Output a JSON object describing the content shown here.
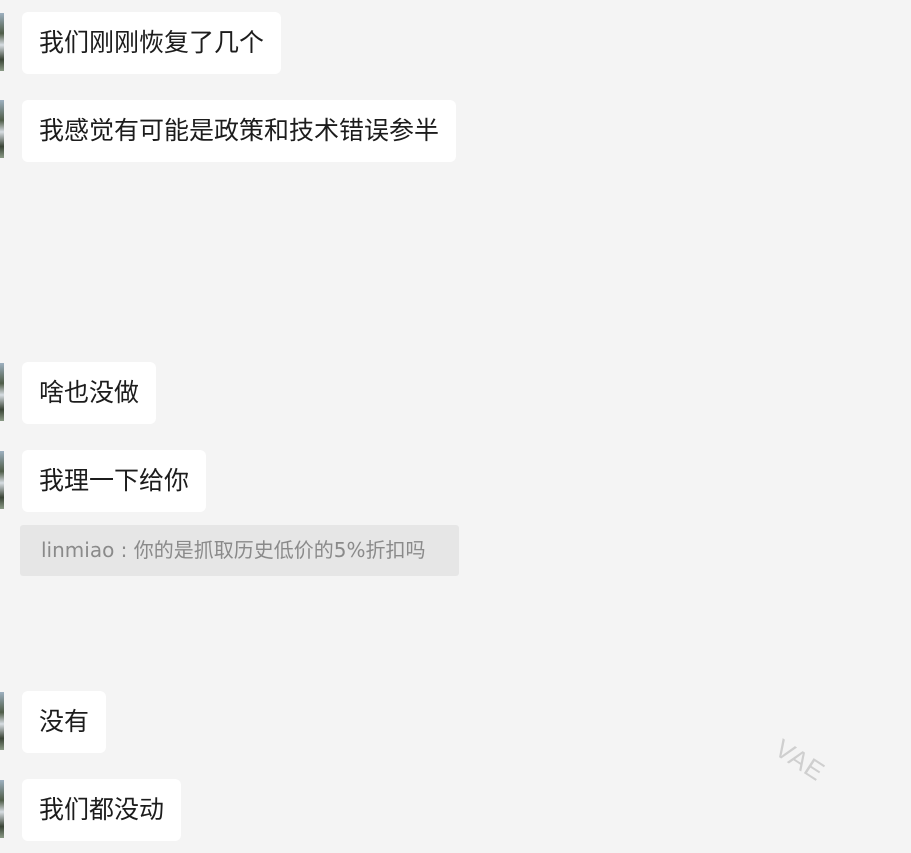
{
  "messages": [
    {
      "text": "我们刚刚恢复了几个"
    },
    {
      "text": "我感觉有可能是政策和技术错误参半"
    },
    {
      "text": "啥也没做"
    },
    {
      "text": "我理一下给你"
    },
    {
      "text": "没有"
    },
    {
      "text": "我们都没动"
    }
  ],
  "quote": {
    "text": "linmiao : 你的是抓取历史低价的5%折扣吗"
  },
  "watermark": {
    "text": "VAE"
  }
}
